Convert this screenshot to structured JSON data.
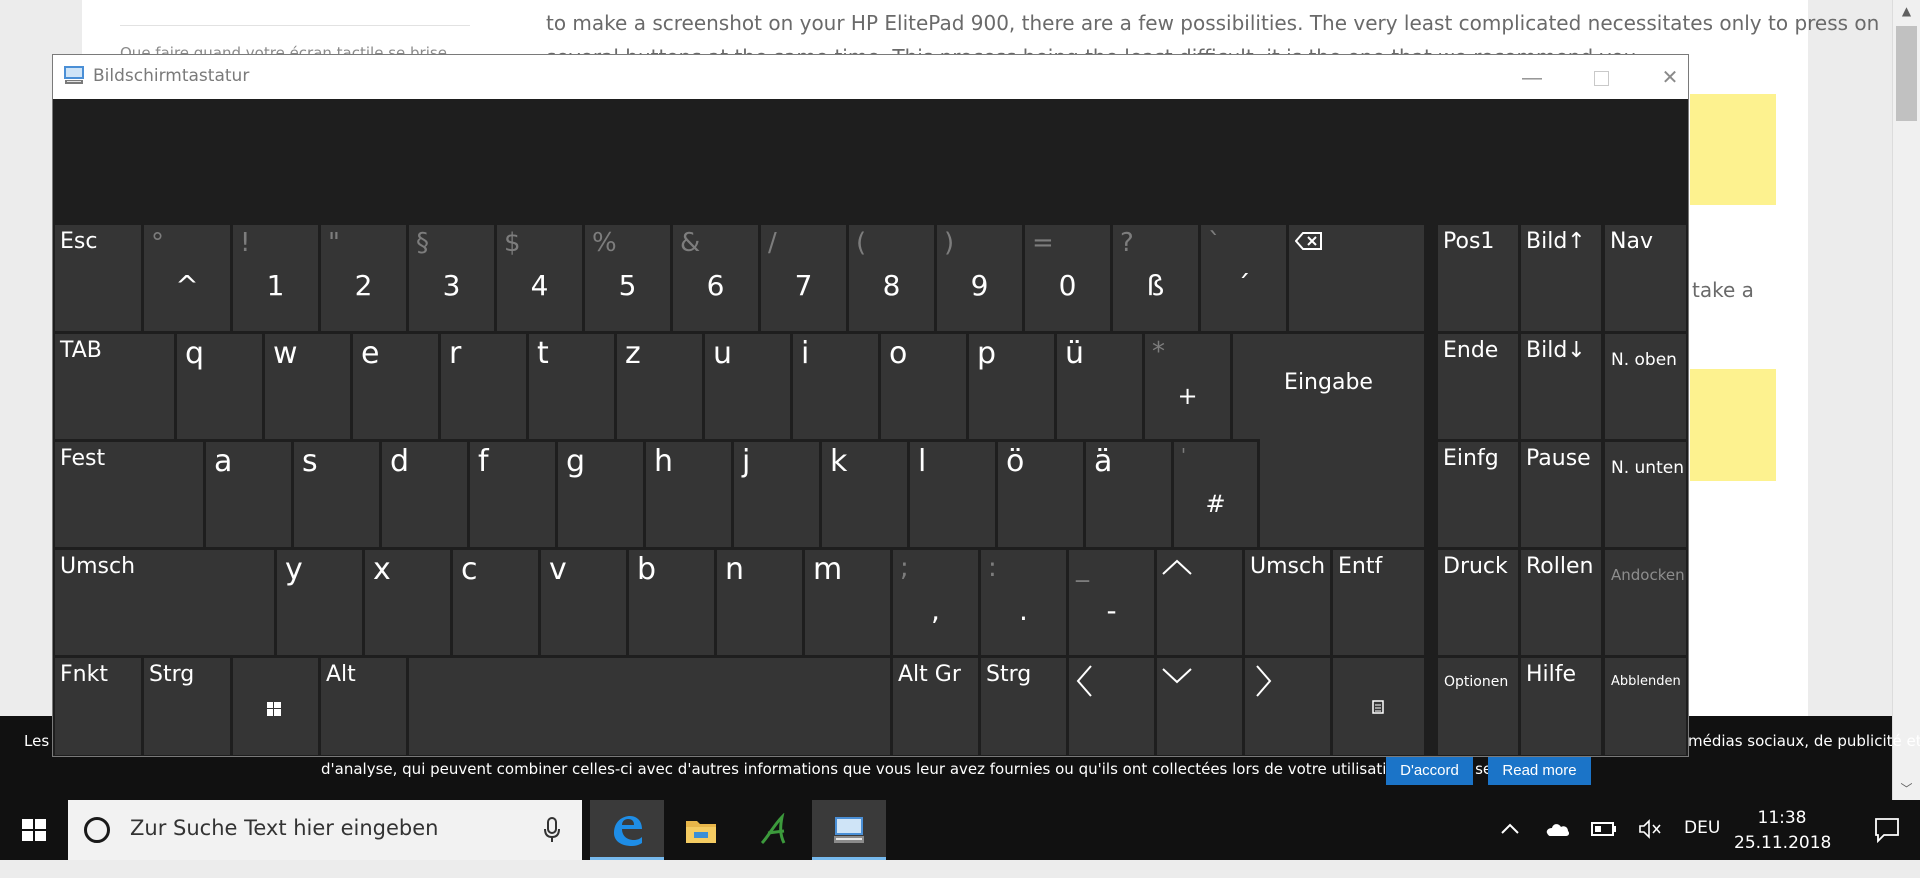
{
  "webpage": {
    "sidebar_link": "Que faire quand votre écran tactile se brise",
    "para1_line1": "to make a screenshot on your HP ElitePad 900, there are a few possibilities. The very least complicated necessitates only to press on",
    "para1_line2": "several buttons at the same time. This process being the least difficult, it is the one that we recommend you.",
    "side_text": "take a"
  },
  "cookie_bar": {
    "text_left": "Les c",
    "text_right": "médias sociaux, de publicité et",
    "text_line2": "d'analyse, qui peuvent combiner celles-ci avec d'autres informations que vous leur avez fournies ou qu'ils ont collectées lors de votre utilisation de leurs services.",
    "accept_label": "D'accord",
    "read_more_label": "Read more"
  },
  "osk": {
    "title": "Bildschirmtastatur",
    "row1": [
      {
        "tl": "Esc"
      },
      {
        "shift": "°",
        "main": "^"
      },
      {
        "shift": "!",
        "main": "1"
      },
      {
        "shift": "\"",
        "main": "2"
      },
      {
        "shift": "§",
        "main": "3"
      },
      {
        "shift": "$",
        "main": "4"
      },
      {
        "shift": "%",
        "main": "5"
      },
      {
        "shift": "&",
        "main": "6"
      },
      {
        "shift": "/",
        "main": "7"
      },
      {
        "shift": "(",
        "main": "8"
      },
      {
        "shift": ")",
        "main": "9"
      },
      {
        "shift": "=",
        "main": "0"
      },
      {
        "shift": "?",
        "main": "ß"
      },
      {
        "shift": "`",
        "main": "´"
      }
    ],
    "row2_tab": "TAB",
    "row2_letters": [
      "q",
      "w",
      "e",
      "r",
      "t",
      "z",
      "u",
      "i",
      "o",
      "p",
      "ü"
    ],
    "row2_plus": {
      "shift": "*",
      "main": "+"
    },
    "enter": "Eingabe",
    "row3_caps": "Fest",
    "row3_letters": [
      "a",
      "s",
      "d",
      "f",
      "g",
      "h",
      "j",
      "k",
      "l",
      "ö",
      "ä"
    ],
    "row3_hash": {
      "shift": "'",
      "main": "#"
    },
    "row4_shift_left": "Umsch",
    "row4_letters": [
      "y",
      "x",
      "c",
      "v",
      "b",
      "n",
      "m"
    ],
    "row4_punct": [
      {
        "shift": ";",
        "main": ","
      },
      {
        "shift": ":",
        "main": "."
      },
      {
        "shift": "_",
        "main": "-"
      }
    ],
    "row4_shift_right": "Umsch",
    "row4_del": "Entf",
    "row5": {
      "fn": "Fnkt",
      "ctrl_left": "Strg",
      "alt": "Alt",
      "altgr": "Alt Gr",
      "ctrl_right": "Strg"
    },
    "nav": {
      "pos1": "Pos1",
      "pgup": "Bild↑",
      "nav": "Nav",
      "end": "Ende",
      "pgdn": "Bild↓",
      "moveup": "N. oben",
      "ins": "Einfg",
      "pause": "Pause",
      "movedown": "N. unten",
      "print": "Druck",
      "scroll": "Rollen",
      "dock": "Andocken",
      "options": "Optionen",
      "help": "Hilfe",
      "fade": "Abblenden"
    }
  },
  "taskbar": {
    "search_placeholder": "Zur Suche Text hier eingeben",
    "language": "DEU",
    "time": "11:38",
    "date": "25.11.2018"
  },
  "colors": {
    "key": "#353535",
    "keyboard_bg": "#1e1e1e",
    "highlight": "#fdf28f",
    "cookie_button": "#1b74c8",
    "taskbar": "#111111"
  }
}
